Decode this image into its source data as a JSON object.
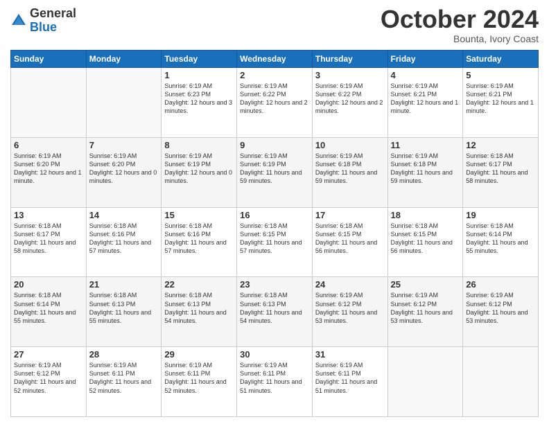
{
  "logo": {
    "general": "General",
    "blue": "Blue"
  },
  "header": {
    "month": "October 2024",
    "location": "Bounta, Ivory Coast"
  },
  "days_of_week": [
    "Sunday",
    "Monday",
    "Tuesday",
    "Wednesday",
    "Thursday",
    "Friday",
    "Saturday"
  ],
  "weeks": [
    [
      {
        "day": "",
        "info": ""
      },
      {
        "day": "",
        "info": ""
      },
      {
        "day": "1",
        "info": "Sunrise: 6:19 AM\nSunset: 6:23 PM\nDaylight: 12 hours and 3 minutes."
      },
      {
        "day": "2",
        "info": "Sunrise: 6:19 AM\nSunset: 6:22 PM\nDaylight: 12 hours and 2 minutes."
      },
      {
        "day": "3",
        "info": "Sunrise: 6:19 AM\nSunset: 6:22 PM\nDaylight: 12 hours and 2 minutes."
      },
      {
        "day": "4",
        "info": "Sunrise: 6:19 AM\nSunset: 6:21 PM\nDaylight: 12 hours and 1 minute."
      },
      {
        "day": "5",
        "info": "Sunrise: 6:19 AM\nSunset: 6:21 PM\nDaylight: 12 hours and 1 minute."
      }
    ],
    [
      {
        "day": "6",
        "info": "Sunrise: 6:19 AM\nSunset: 6:20 PM\nDaylight: 12 hours and 1 minute."
      },
      {
        "day": "7",
        "info": "Sunrise: 6:19 AM\nSunset: 6:20 PM\nDaylight: 12 hours and 0 minutes."
      },
      {
        "day": "8",
        "info": "Sunrise: 6:19 AM\nSunset: 6:19 PM\nDaylight: 12 hours and 0 minutes."
      },
      {
        "day": "9",
        "info": "Sunrise: 6:19 AM\nSunset: 6:19 PM\nDaylight: 11 hours and 59 minutes."
      },
      {
        "day": "10",
        "info": "Sunrise: 6:19 AM\nSunset: 6:18 PM\nDaylight: 11 hours and 59 minutes."
      },
      {
        "day": "11",
        "info": "Sunrise: 6:19 AM\nSunset: 6:18 PM\nDaylight: 11 hours and 59 minutes."
      },
      {
        "day": "12",
        "info": "Sunrise: 6:18 AM\nSunset: 6:17 PM\nDaylight: 11 hours and 58 minutes."
      }
    ],
    [
      {
        "day": "13",
        "info": "Sunrise: 6:18 AM\nSunset: 6:17 PM\nDaylight: 11 hours and 58 minutes."
      },
      {
        "day": "14",
        "info": "Sunrise: 6:18 AM\nSunset: 6:16 PM\nDaylight: 11 hours and 57 minutes."
      },
      {
        "day": "15",
        "info": "Sunrise: 6:18 AM\nSunset: 6:16 PM\nDaylight: 11 hours and 57 minutes."
      },
      {
        "day": "16",
        "info": "Sunrise: 6:18 AM\nSunset: 6:15 PM\nDaylight: 11 hours and 57 minutes."
      },
      {
        "day": "17",
        "info": "Sunrise: 6:18 AM\nSunset: 6:15 PM\nDaylight: 11 hours and 56 minutes."
      },
      {
        "day": "18",
        "info": "Sunrise: 6:18 AM\nSunset: 6:15 PM\nDaylight: 11 hours and 56 minutes."
      },
      {
        "day": "19",
        "info": "Sunrise: 6:18 AM\nSunset: 6:14 PM\nDaylight: 11 hours and 55 minutes."
      }
    ],
    [
      {
        "day": "20",
        "info": "Sunrise: 6:18 AM\nSunset: 6:14 PM\nDaylight: 11 hours and 55 minutes."
      },
      {
        "day": "21",
        "info": "Sunrise: 6:18 AM\nSunset: 6:13 PM\nDaylight: 11 hours and 55 minutes."
      },
      {
        "day": "22",
        "info": "Sunrise: 6:18 AM\nSunset: 6:13 PM\nDaylight: 11 hours and 54 minutes."
      },
      {
        "day": "23",
        "info": "Sunrise: 6:18 AM\nSunset: 6:13 PM\nDaylight: 11 hours and 54 minutes."
      },
      {
        "day": "24",
        "info": "Sunrise: 6:19 AM\nSunset: 6:12 PM\nDaylight: 11 hours and 53 minutes."
      },
      {
        "day": "25",
        "info": "Sunrise: 6:19 AM\nSunset: 6:12 PM\nDaylight: 11 hours and 53 minutes."
      },
      {
        "day": "26",
        "info": "Sunrise: 6:19 AM\nSunset: 6:12 PM\nDaylight: 11 hours and 53 minutes."
      }
    ],
    [
      {
        "day": "27",
        "info": "Sunrise: 6:19 AM\nSunset: 6:12 PM\nDaylight: 11 hours and 52 minutes."
      },
      {
        "day": "28",
        "info": "Sunrise: 6:19 AM\nSunset: 6:11 PM\nDaylight: 11 hours and 52 minutes."
      },
      {
        "day": "29",
        "info": "Sunrise: 6:19 AM\nSunset: 6:11 PM\nDaylight: 11 hours and 52 minutes."
      },
      {
        "day": "30",
        "info": "Sunrise: 6:19 AM\nSunset: 6:11 PM\nDaylight: 11 hours and 51 minutes."
      },
      {
        "day": "31",
        "info": "Sunrise: 6:19 AM\nSunset: 6:11 PM\nDaylight: 11 hours and 51 minutes."
      },
      {
        "day": "",
        "info": ""
      },
      {
        "day": "",
        "info": ""
      }
    ]
  ]
}
